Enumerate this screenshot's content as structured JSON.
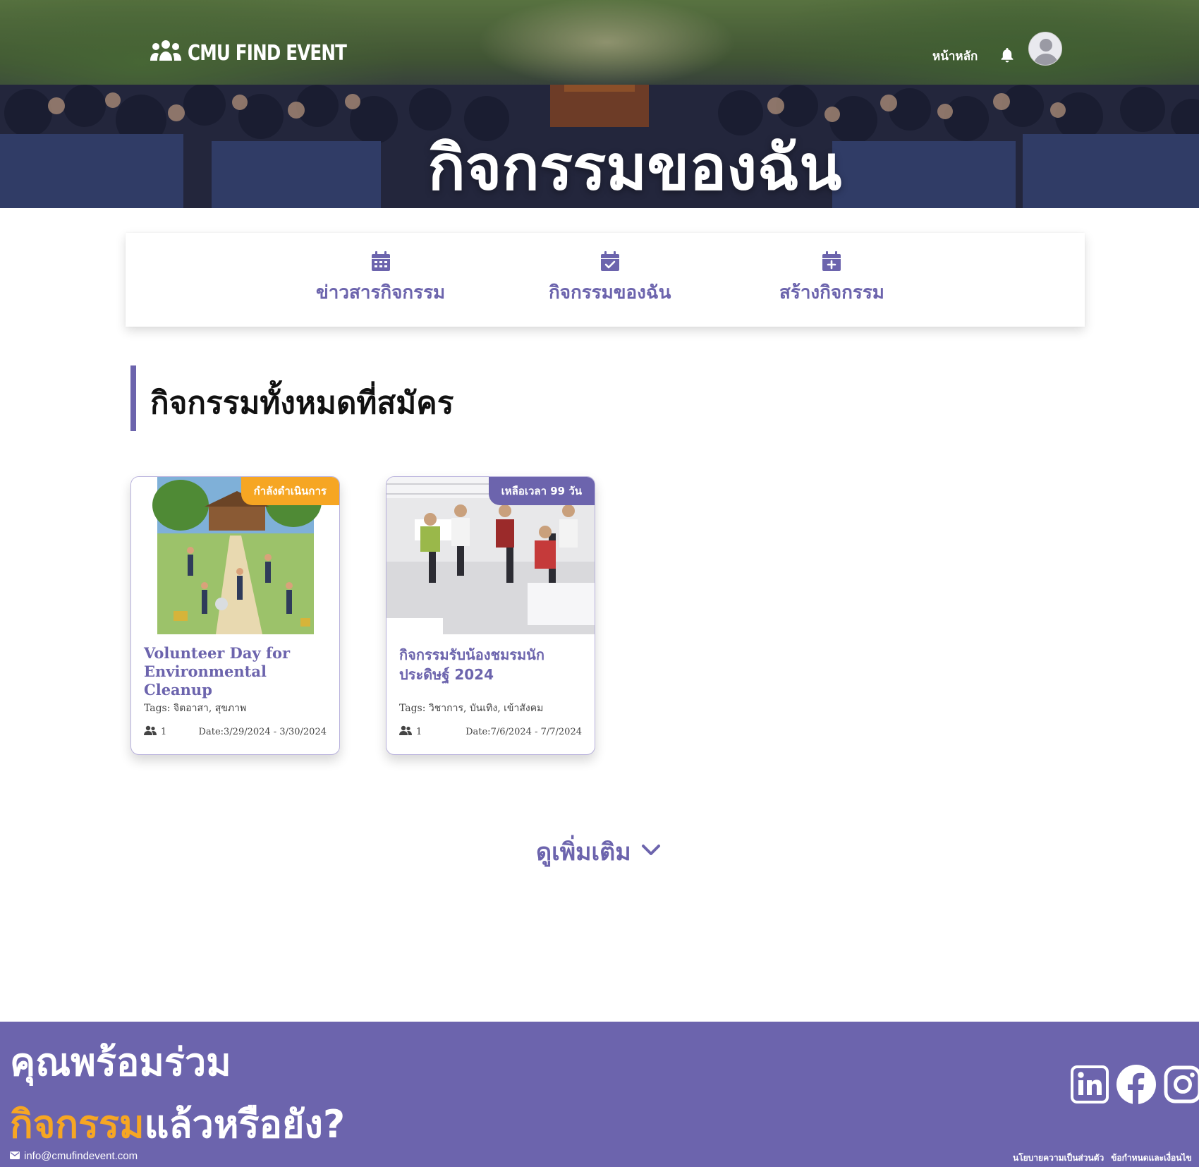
{
  "brand": {
    "name": "CMU FIND EVENT"
  },
  "nav": {
    "home_label": "หน้าหลัก"
  },
  "hero": {
    "title": "กิจกรรมของฉัน"
  },
  "menu": {
    "items": [
      {
        "label": "ข่าวสารกิจกรรม",
        "icon": "calendar-icon"
      },
      {
        "label": "กิจกรรมของฉัน",
        "icon": "calendar-check-icon"
      },
      {
        "label": "สร้างกิจกรรม",
        "icon": "calendar-plus-icon"
      }
    ]
  },
  "section": {
    "title": "กิจกรรมทั้งหมดที่สมัคร"
  },
  "events": [
    {
      "badge": "กำลังดำเนินการ",
      "badge_color": "#f6a623",
      "name": "Volunteer Day for Environmental Cleanup",
      "tags": "Tags: จิตอาสา, สุขภาพ",
      "participants": "1",
      "date": "Date:3/29/2024 - 3/30/2024"
    },
    {
      "badge": "เหลือเวลา 99 วัน",
      "badge_color": "#6c64ad",
      "name": "กิจกรรมรับน้องชมรมนักประดิษฐ์ 2024",
      "tags": "Tags: วิชาการ, บันเทิง, เข้าสังคม",
      "participants": "1",
      "date": "Date:7/6/2024 - 7/7/2024"
    }
  ],
  "more": {
    "label": "ดูเพิ่มเติม"
  },
  "footer": {
    "line1": "คุณพร้อมร่วม",
    "line2_highlight": "กิจกรรม",
    "line2_rest": "แล้วหรือยัง?",
    "email": "info@cmufindevent.com",
    "links": [
      "นโยบายความเป็นส่วนตัว",
      "ข้อกำหนดและเงื่อนไข"
    ],
    "social": [
      "linkedin-icon",
      "facebook-icon",
      "instagram-icon"
    ]
  },
  "colors": {
    "primary": "#6c64ad",
    "accent": "#f6a623"
  }
}
